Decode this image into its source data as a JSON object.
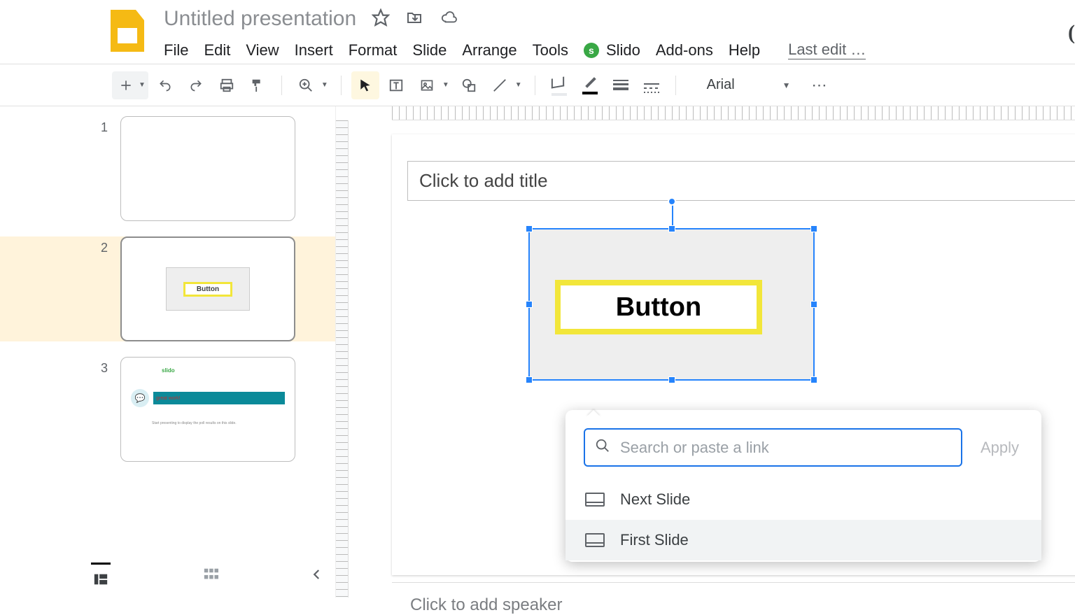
{
  "header": {
    "doc_title": "Untitled presentation",
    "last_edit": "Last edit …"
  },
  "menu": {
    "file": "File",
    "edit": "Edit",
    "view": "View",
    "insert": "Insert",
    "format": "Format",
    "slide": "Slide",
    "arrange": "Arrange",
    "tools": "Tools",
    "slido_badge": "s",
    "slido": "Slido",
    "addons": "Add-ons",
    "help": "Help"
  },
  "toolbar": {
    "font": "Arial"
  },
  "thumbs": {
    "n1": "1",
    "n2": "2",
    "n3": "3",
    "t2_button": "Button",
    "t3_slido": "slido",
    "t3_text": "great work!",
    "t3_footer": "Start presenting to display the poll results on this slide."
  },
  "canvas": {
    "title_placeholder": "Click to add title",
    "button_label": "Button",
    "speaker_notes": "Click to add speaker"
  },
  "link": {
    "placeholder": "Search or paste a link",
    "apply": "Apply",
    "opt_next": "Next Slide",
    "opt_first": "First Slide"
  }
}
